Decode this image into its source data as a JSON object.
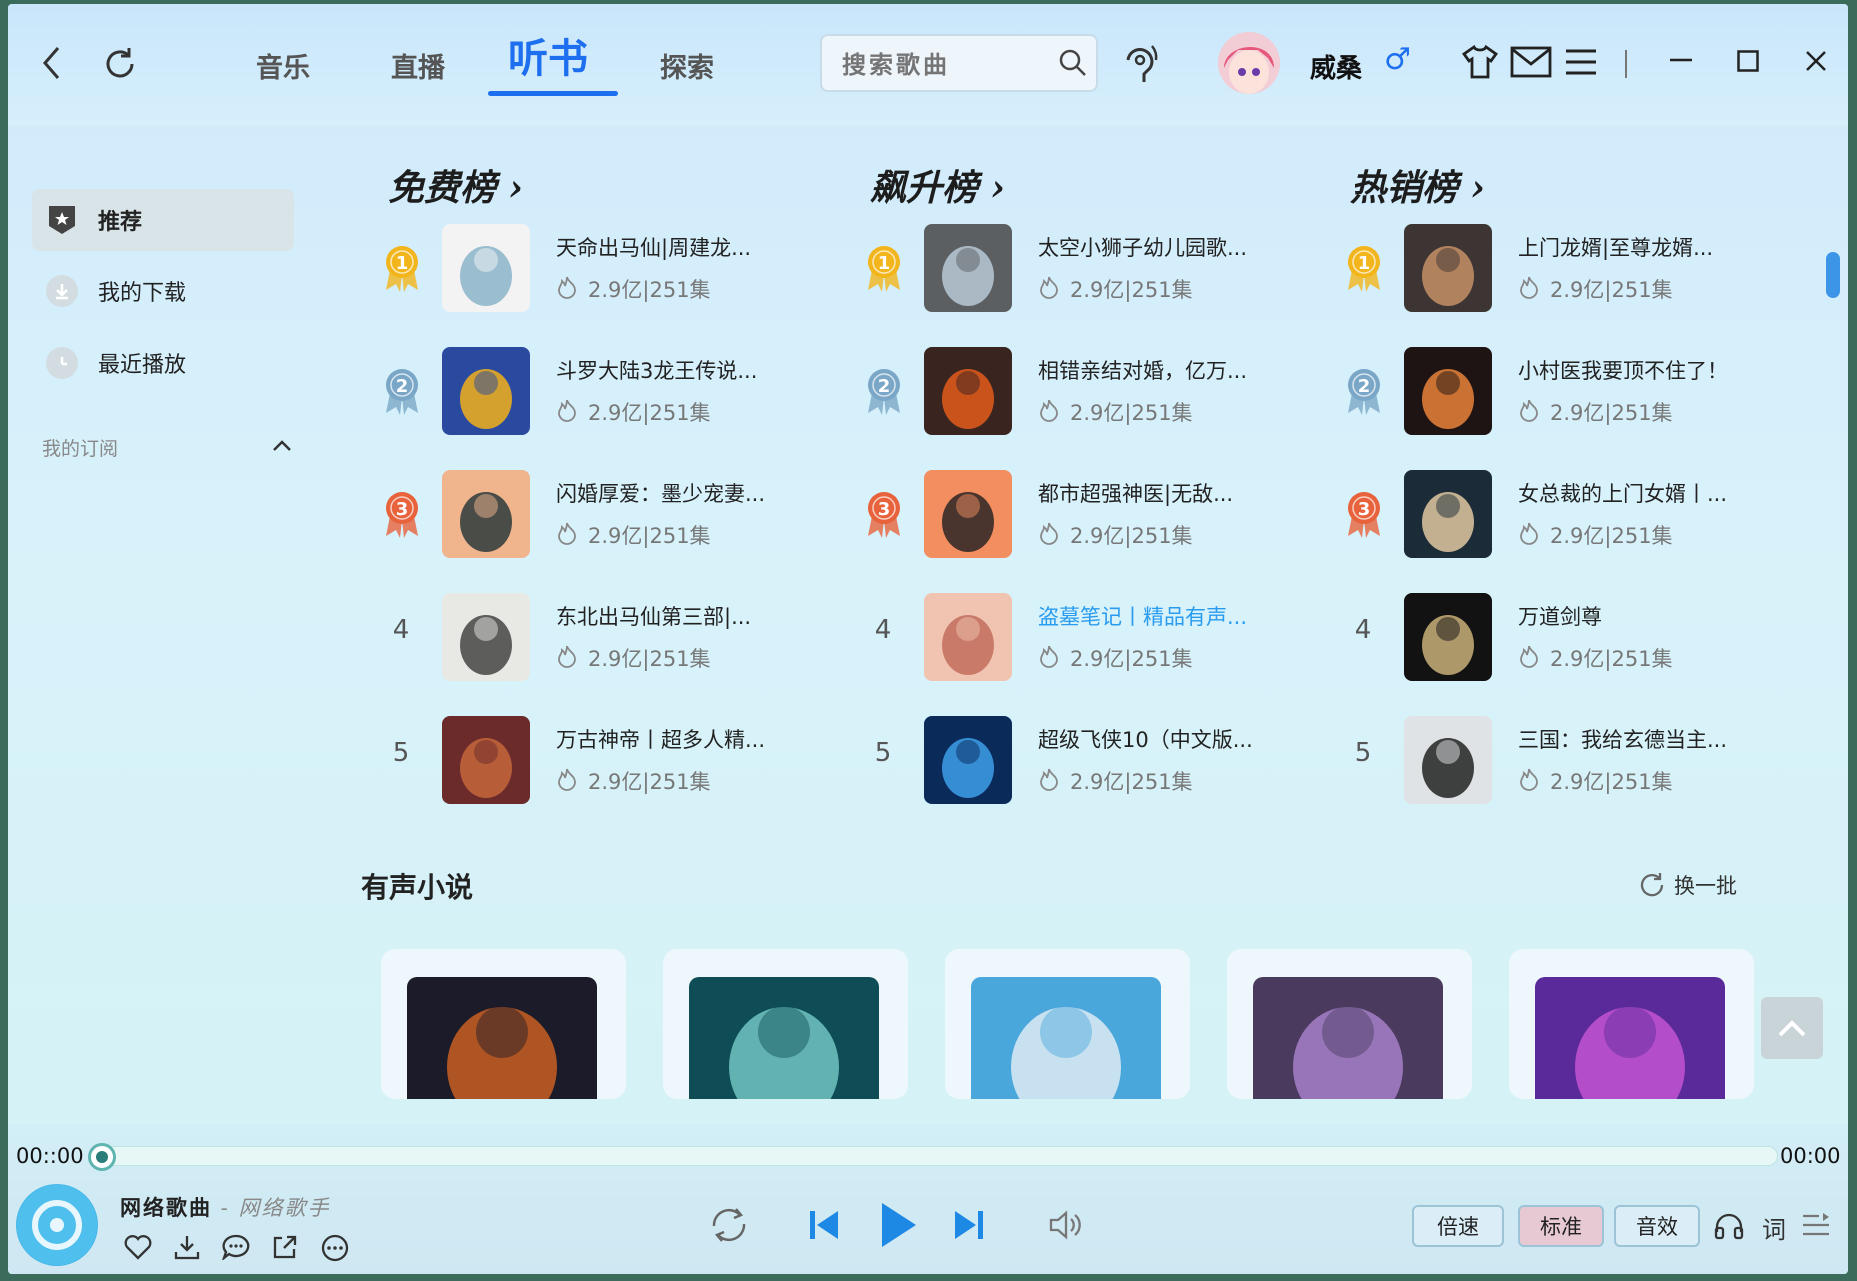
{
  "header": {
    "tabs": [
      "音乐",
      "直播",
      "听书",
      "探索"
    ],
    "active_tab": "听书",
    "search_placeholder": "搜索歌曲",
    "user_name": "威桑",
    "gender_symbol": "♂"
  },
  "sidebar": {
    "items": [
      {
        "label": "推荐",
        "active": true
      },
      {
        "label": "我的下载",
        "active": false
      },
      {
        "label": "最近播放",
        "active": false
      }
    ],
    "subscription_label": "我的订阅"
  },
  "rankings": [
    {
      "title": "免费榜",
      "arrow": "›",
      "books": [
        {
          "rank": "1",
          "title": "天命出马仙|周建龙...",
          "meta": "2.9亿|251集"
        },
        {
          "rank": "2",
          "title": "斗罗大陆3龙王传说...",
          "meta": "2.9亿|251集"
        },
        {
          "rank": "3",
          "title": "闪婚厚爱：墨少宠妻...",
          "meta": "2.9亿|251集"
        },
        {
          "rank": "4",
          "title": "东北出马仙第三部|...",
          "meta": "2.9亿|251集"
        },
        {
          "rank": "5",
          "title": "万古神帝丨超多人精...",
          "meta": "2.9亿|251集"
        }
      ]
    },
    {
      "title": "飙升榜",
      "arrow": "›",
      "books": [
        {
          "rank": "1",
          "title": "太空小狮子幼儿园歌...",
          "meta": "2.9亿|251集"
        },
        {
          "rank": "2",
          "title": "相错亲结对婚，亿万...",
          "meta": "2.9亿|251集"
        },
        {
          "rank": "3",
          "title": "都市超强神医|无敌...",
          "meta": "2.9亿|251集"
        },
        {
          "rank": "4",
          "title": "盗墓笔记丨精品有声...",
          "meta": "2.9亿|251集"
        },
        {
          "rank": "5",
          "title": "超级飞侠10（中文版...",
          "meta": "2.9亿|251集"
        }
      ]
    },
    {
      "title": "热销榜",
      "arrow": "›",
      "books": [
        {
          "rank": "1",
          "title": "上门龙婿|至尊龙婿...",
          "meta": "2.9亿|251集"
        },
        {
          "rank": "2",
          "title": "小村医我要顶不住了！",
          "meta": "2.9亿|251集"
        },
        {
          "rank": "3",
          "title": "女总裁的上门女婿丨...",
          "meta": "2.9亿|251集"
        },
        {
          "rank": "4",
          "title": "万道剑尊",
          "meta": "2.9亿|251集"
        },
        {
          "rank": "5",
          "title": "三国：我给玄德当主...",
          "meta": "2.9亿|251集"
        }
      ]
    }
  ],
  "section": {
    "title": "有声小说",
    "refresh_label": "换一批"
  },
  "player": {
    "time_current": "00::00",
    "time_total": "00:00",
    "progress": 0,
    "song_title": "网络歌曲",
    "separator": " - ",
    "artist": "网络歌手",
    "speed_label": "倍速",
    "quality_label": "标准",
    "effects_label": "音效",
    "lyrics_label": "词"
  },
  "colors": {
    "accent": "#1e6ff0",
    "highlight_link": "#2a9cf0",
    "gold": "#f2b51c",
    "silver": "#7aa7c7",
    "bronze": "#e8623c"
  }
}
